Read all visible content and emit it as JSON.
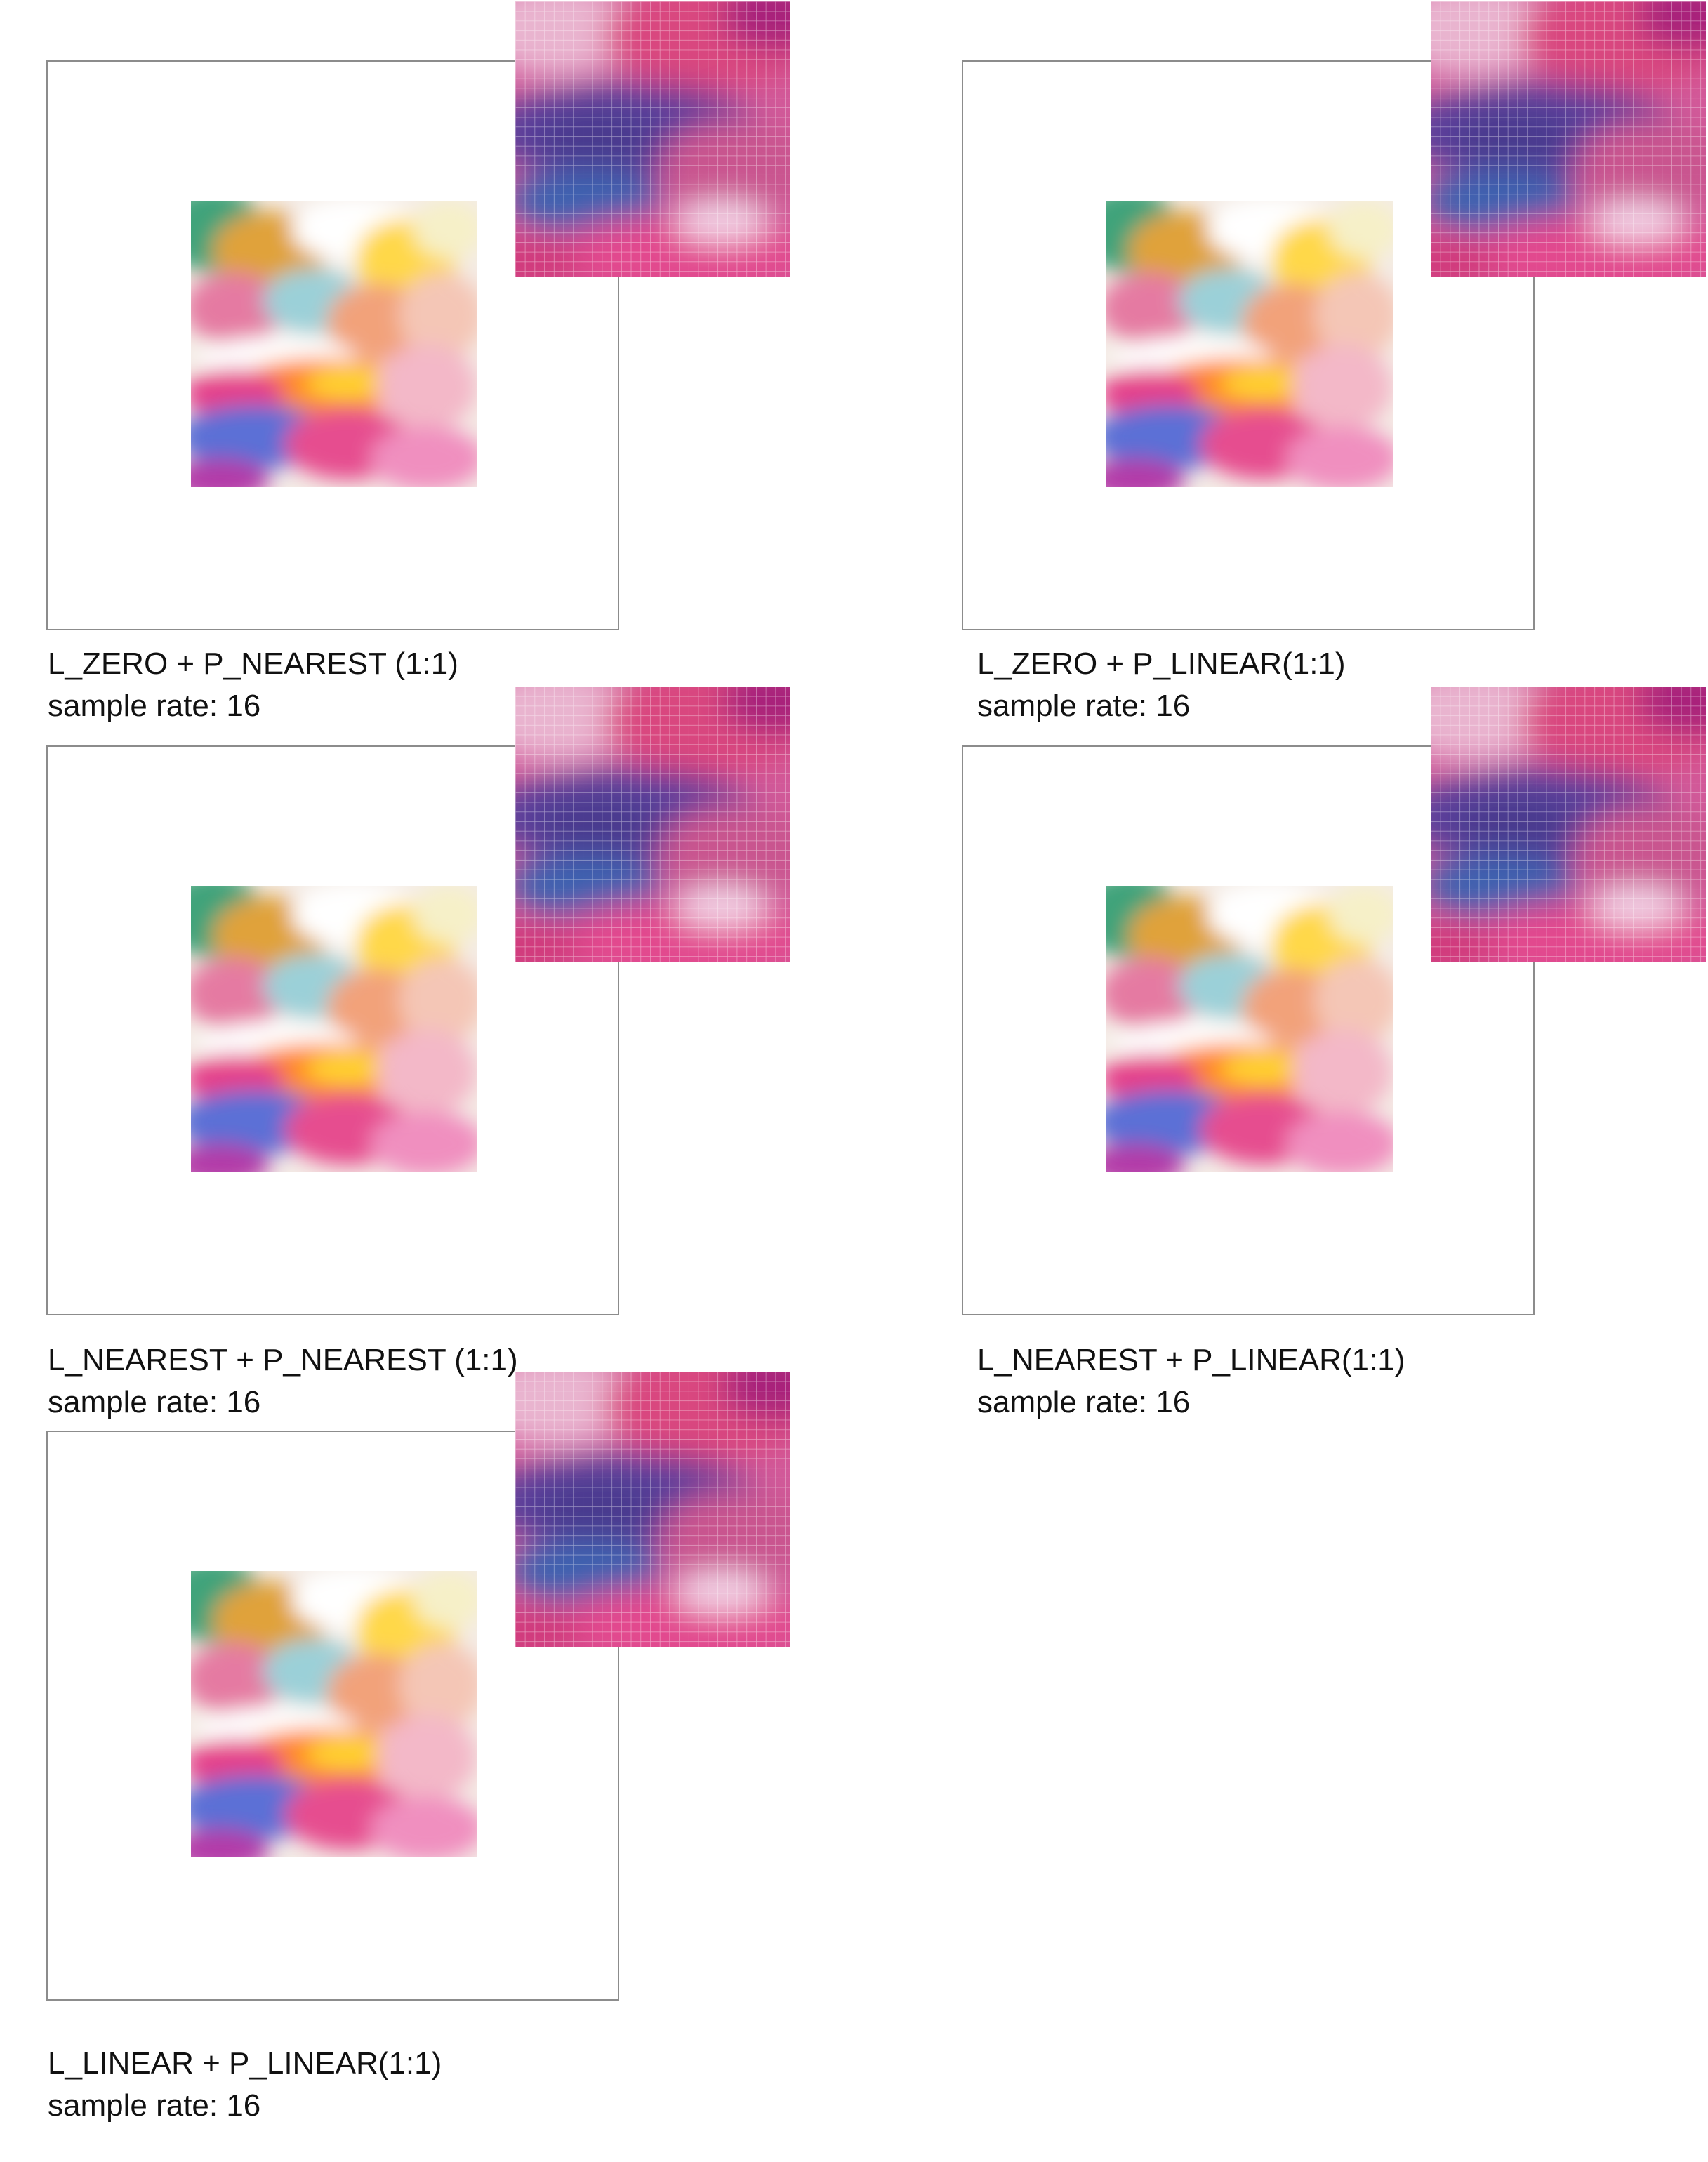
{
  "panels": [
    {
      "title": "L_ZERO + P_NEAREST (1:1)",
      "subtitle": "sample rate: 16"
    },
    {
      "title": "L_ZERO + P_LINEAR(1:1)",
      "subtitle": "sample rate: 16"
    },
    {
      "title": "L_NEAREST + P_NEAREST (1:1)",
      "subtitle": "sample rate: 16"
    },
    {
      "title": "L_NEAREST + P_LINEAR(1:1)",
      "subtitle": "sample rate: 16"
    },
    {
      "title": "L_LINEAR + P_LINEAR(1:1)",
      "subtitle": "sample rate: 16"
    }
  ],
  "colors": {
    "frame_border": "#8c8c8c",
    "grid_line": "#ffffff"
  }
}
